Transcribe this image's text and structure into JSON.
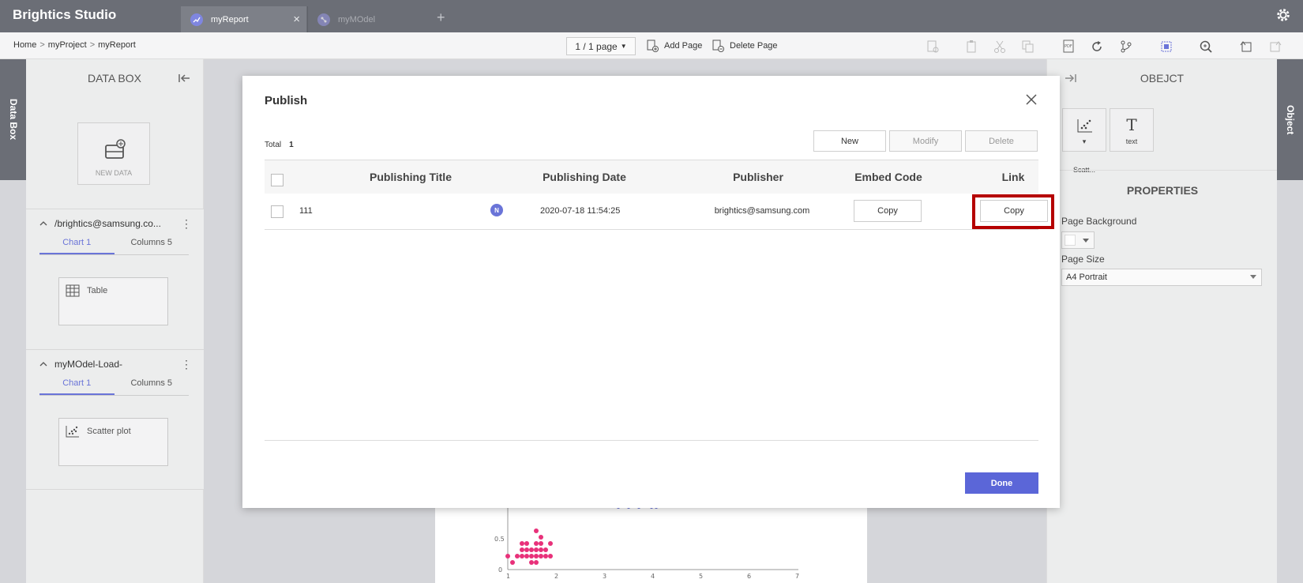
{
  "app": {
    "title": "Brightics Studio",
    "tabs": [
      {
        "label": "myReport",
        "active": true
      },
      {
        "label": "myMOdel",
        "active": false
      }
    ]
  },
  "toolbar": {
    "breadcrumb": [
      "Home",
      "myProject",
      "myReport"
    ],
    "pager": "1 / 1 page",
    "add_page": "Add Page",
    "delete_page": "Delete Page"
  },
  "left_strip": {
    "label": "Data Box"
  },
  "right_strip": {
    "label": "Object"
  },
  "databox": {
    "title": "DATA BOX",
    "new_data": "NEW DATA",
    "sections": [
      {
        "title": "/brightics@samsung.co...",
        "tabs": [
          "Chart 1",
          "Columns 5"
        ],
        "card": "Table"
      },
      {
        "title": "myMOdel-Load-",
        "tabs": [
          "Chart 1",
          "Columns 5"
        ],
        "card": "Scatter plot"
      }
    ]
  },
  "object_panel": {
    "title": "OBEJCT",
    "items": [
      "Scatt...",
      "text"
    ],
    "properties_title": "PROPERTIES",
    "page_background_label": "Page Background",
    "page_size_label": "Page Size",
    "page_size_value": "A4 Portrait"
  },
  "modal": {
    "title": "Publish",
    "total_label": "Total",
    "total_value": "1",
    "buttons": {
      "new": "New",
      "modify": "Modify",
      "delete": "Delete"
    },
    "columns": {
      "title": "Publishing Title",
      "date": "Publishing Date",
      "publisher": "Publisher",
      "embed": "Embed Code",
      "link": "Link"
    },
    "rows": [
      {
        "title": "111",
        "badge": "N",
        "date": "2020-07-18 11:54:25",
        "publisher": "brightics@samsung.com",
        "embed": "Copy",
        "link": "Copy"
      }
    ],
    "done": "Done"
  },
  "colors": {
    "accent": "#5b66d8",
    "highlight": "#b50000",
    "topbar": "#6b6e76"
  }
}
